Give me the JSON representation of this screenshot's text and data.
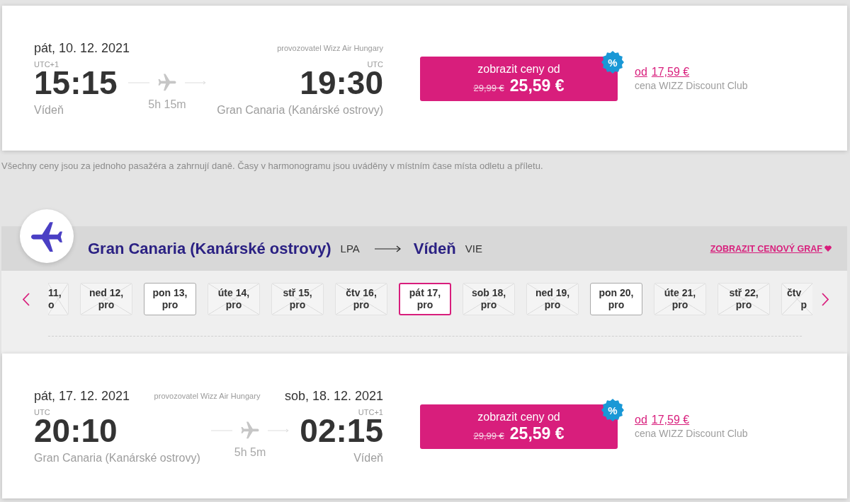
{
  "outbound_flight": {
    "departure": {
      "date": "pát, 10. 12. 2021",
      "timezone": "UTC+1",
      "time": "15:15",
      "city": "Vídeň"
    },
    "operator": "provozovatel Wizz Air Hungary",
    "duration": "5h 15m",
    "arrival": {
      "timezone": "UTC",
      "time": "19:30",
      "city": "Gran Canaria (Kanárské ostrovy)"
    },
    "price_button": {
      "label": "zobrazit ceny od",
      "old_price": "29,99 €",
      "price": "25,59 €",
      "badge": "%"
    },
    "club_price": {
      "prefix": "od",
      "price": "17,59 €",
      "note": "cena WIZZ Discount Club"
    }
  },
  "disclaimer": "Všechny ceny jsou za jednoho pasažéra a zahrnují daně. Časy v harmonogramu jsou uváděny v místním čase místa odletu a příletu.",
  "return_route": {
    "origin": "Gran Canaria (Kanárské ostrovy)",
    "origin_code": "LPA",
    "destination": "Vídeň",
    "destination_code": "VIE",
    "chart_link": "ZOBRAZIT CENOVÝ GRAF"
  },
  "return_dates": [
    {
      "kind": "clipped-start",
      "day": "11,",
      "month": "o",
      "available": false,
      "selected": false
    },
    {
      "kind": "day",
      "day": "ned 12,",
      "month": "pro",
      "available": false,
      "selected": false
    },
    {
      "kind": "day",
      "day": "pon 13,",
      "month": "pro",
      "available": true,
      "selected": false
    },
    {
      "kind": "day",
      "day": "úte 14,",
      "month": "pro",
      "available": false,
      "selected": false
    },
    {
      "kind": "day",
      "day": "stř 15,",
      "month": "pro",
      "available": false,
      "selected": false
    },
    {
      "kind": "day",
      "day": "čtv 16,",
      "month": "pro",
      "available": false,
      "selected": false
    },
    {
      "kind": "day",
      "day": "pát 17,",
      "month": "pro",
      "available": true,
      "selected": true
    },
    {
      "kind": "day",
      "day": "sob 18,",
      "month": "pro",
      "available": false,
      "selected": false
    },
    {
      "kind": "day",
      "day": "ned 19,",
      "month": "pro",
      "available": false,
      "selected": false
    },
    {
      "kind": "day",
      "day": "pon 20,",
      "month": "pro",
      "available": true,
      "selected": false
    },
    {
      "kind": "day",
      "day": "úte 21,",
      "month": "pro",
      "available": false,
      "selected": false
    },
    {
      "kind": "day",
      "day": "stř 22,",
      "month": "pro",
      "available": false,
      "selected": false
    },
    {
      "kind": "clipped-end",
      "day": "čtv",
      "month": "p",
      "available": false,
      "selected": false
    }
  ],
  "return_flight": {
    "departure": {
      "date": "pát, 17. 12. 2021",
      "timezone": "UTC",
      "time": "20:10",
      "city": "Gran Canaria (Kanárské ostrovy)"
    },
    "operator": "provozovatel Wizz Air Hungary",
    "duration": "5h 5m",
    "arrival": {
      "date": "sob, 18. 12. 2021",
      "timezone": "UTC+1",
      "time": "02:15",
      "city": "Vídeň"
    },
    "price_button": {
      "label": "zobrazit ceny od",
      "old_price": "29,99 €",
      "price": "25,59 €",
      "badge": "%"
    },
    "club_price": {
      "prefix": "od",
      "price": "17,59 €",
      "note": "cena WIZZ Discount Club"
    }
  }
}
